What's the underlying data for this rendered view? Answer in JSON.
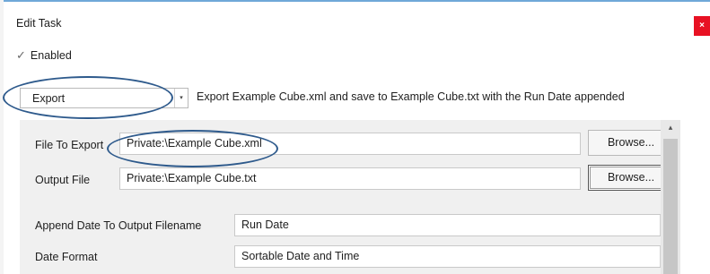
{
  "dialog": {
    "title": "Edit Task",
    "close_glyph": "×"
  },
  "enabled": {
    "label": "Enabled",
    "checked": true,
    "check_glyph": "✓"
  },
  "action": {
    "value": "Export",
    "description": "Export Example Cube.xml and save to Example Cube.txt with the Run Date appended",
    "arrow_glyph": "▾"
  },
  "form": {
    "file_to_export_label": "File To Export",
    "file_to_export_value": "Private:\\Example Cube.xml",
    "output_file_label": "Output File",
    "output_file_value": "Private:\\Example Cube.txt",
    "browse_label": "Browse...",
    "append_date_label": "Append Date To Output Filename",
    "append_date_value": "Run Date",
    "date_format_label": "Date Format",
    "date_format_value": "Sortable Date and Time",
    "dropdown_glyph": "▾"
  },
  "scrollbar": {
    "up_glyph": "▴"
  },
  "colors": {
    "close": "#e81123",
    "highlight_ellipse": "#2e5a8c",
    "panel": "#f0f0f0"
  }
}
